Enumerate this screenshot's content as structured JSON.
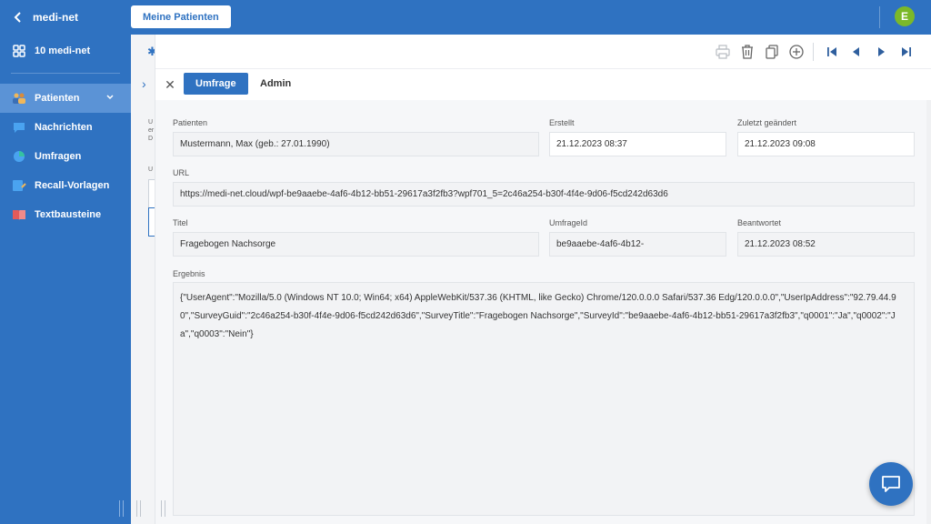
{
  "header": {
    "back_label": "medi-net",
    "top_tab": "Meine Patienten",
    "avatar_letter": "E"
  },
  "sidebar": {
    "app_label": "10 medi-net",
    "items": [
      {
        "label": "Patienten",
        "icon": "patients-icon",
        "active": true
      },
      {
        "label": "Nachrichten",
        "icon": "message-icon"
      },
      {
        "label": "Umfragen",
        "icon": "survey-pie-icon"
      },
      {
        "label": "Recall-Vorlagen",
        "icon": "recall-template-icon"
      },
      {
        "label": "Textbausteine",
        "icon": "book-icon"
      }
    ]
  },
  "toolbar": {
    "icons": [
      "print-icon",
      "trash-icon",
      "copy-icon",
      "add-circle-icon",
      "first-page-icon",
      "prev-icon",
      "next-icon",
      "last-page-icon"
    ]
  },
  "tabs": [
    {
      "label": "Umfrage",
      "active": true
    },
    {
      "label": "Admin",
      "active": false
    }
  ],
  "form": {
    "patienten_label": "Patienten",
    "patienten_value": "Mustermann, Max (geb.: 27.01.1990)",
    "erstellt_label": "Erstellt",
    "erstellt_value": "21.12.2023 08:37",
    "geaendert_label": "Zuletzt geändert",
    "geaendert_value": "21.12.2023 09:08",
    "url_label": "URL",
    "url_value": "https://medi-net.cloud/wpf-be9aaebe-4af6-4b12-bb51-29617a3f2fb3?wpf701_5=2c46a254-b30f-4f4e-9d06-f5cd242d63d6",
    "titel_label": "Titel",
    "titel_value": "Fragebogen Nachsorge",
    "umfrageid_label": "UmfrageId",
    "umfrageid_value": "be9aaebe-4af6-4b12-",
    "beantwortet_label": "Beantwortet",
    "beantwortet_value": "21.12.2023 08:52",
    "ergebnis_label": "Ergebnis",
    "ergebnis_value": "{\"UserAgent\":\"Mozilla/5.0 (Windows NT 10.0; Win64; x64) AppleWebKit/537.36 (KHTML, like Gecko) Chrome/120.0.0.0 Safari/537.36 Edg/120.0.0.0\",\"UserIpAddress\":\"92.79.44.90\",\"SurveyGuid\":\"2c46a254-b30f-4f4e-9d06-f5cd242d63d6\",\"SurveyTitle\":\"Fragebogen Nachsorge\",\"SurveyId\":\"be9aaebe-4af6-4b12-bb51-29617a3f2fb3\",\"q0001\":\"Ja\",\"q0002\":\"Ja\",\"q0003\":\"Nein\"}"
  },
  "background": {
    "text_lines": [
      "U",
      "er",
      "D"
    ],
    "label": "U"
  },
  "colors": {
    "brand": "#2f72c1",
    "avatar": "#7bb829"
  }
}
